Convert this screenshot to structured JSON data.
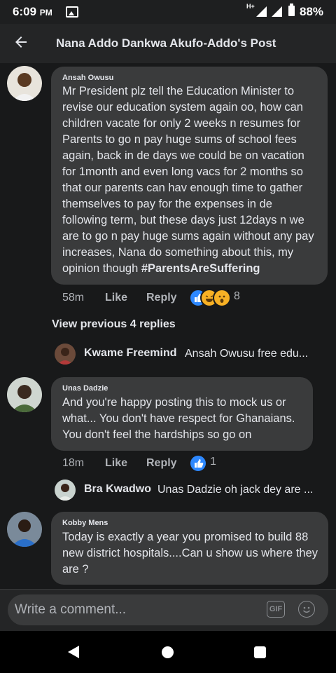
{
  "status_bar": {
    "time": "6:09",
    "ampm": "PM",
    "network": "H+",
    "battery": "88%"
  },
  "header": {
    "title": "Nana Addo Dankwa Akufo-Addo's Post"
  },
  "comments": [
    {
      "author": "Ansah Owusu",
      "text": "Mr President plz tell the Education Minister to revise our education system again oo, how can children vacate for only 2 weeks n resumes for Parents to go n pay huge sums of school fees again, back in de days we could be on vacation for 1month and even long vacs for 2 months so that our parents can hav enough time to gather themselves to pay for the expenses in de following term, but these days just 12days n we are to go n pay huge sums again without any pay increases, Nana do something about this, my opinion though ",
      "hashtag": "#ParentsAreSuffering",
      "time": "58m",
      "like_label": "Like",
      "reply_label": "Reply",
      "reaction_count": "8",
      "reactions": [
        "like",
        "haha",
        "wow"
      ]
    },
    {
      "author": "Unas Dadzie",
      "text": "And you're happy posting this to mock us or what... You don't have respect for Ghanaians. You don't feel the hardships so go on",
      "time": "18m",
      "like_label": "Like",
      "reply_label": "Reply",
      "reaction_count": "1",
      "reactions": [
        "like"
      ]
    },
    {
      "author": "Kobby Mens",
      "text": "Today is exactly a year you promised to build 88 new district hospitals....Can u show us where they are ?"
    }
  ],
  "view_previous": "View previous 4 replies",
  "replies": [
    {
      "name": "Kwame Freemind",
      "snippet": "Ansah Owusu free edu..."
    },
    {
      "name": "Bra Kwadwo",
      "snippet": "Unas Dadzie oh jack dey are ..."
    }
  ],
  "composer": {
    "placeholder": "Write a comment...",
    "gif_label": "GIF"
  },
  "colors": {
    "background": "#18191a",
    "bubble": "#3a3b3c",
    "like_blue": "#2d88ff",
    "text": "#e4e6eb",
    "muted": "#b0b3b8"
  },
  "icons": [
    "back-arrow-icon",
    "gallery-icon",
    "signal-icon",
    "battery-icon",
    "gif-icon",
    "emoji-icon",
    "like-reaction-icon",
    "haha-reaction-icon",
    "wow-reaction-icon"
  ]
}
